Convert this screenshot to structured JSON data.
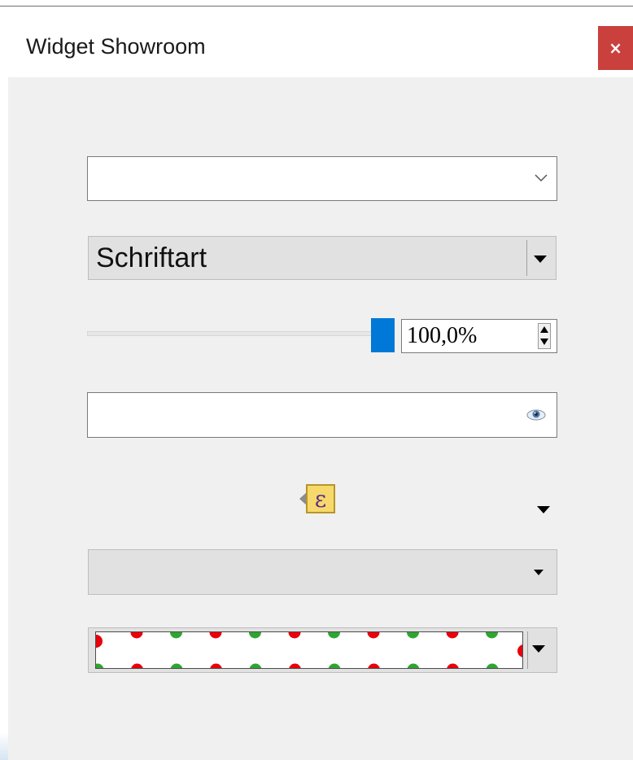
{
  "window": {
    "title": "Widget Showroom",
    "close_label": "×"
  },
  "icons": {
    "combo1_arrow": "chevron-down-icon",
    "font_dropdown": "triangle-down-icon",
    "spin_up": "spin-up-icon",
    "spin_down": "spin-down-icon",
    "password_toggle": "eye-icon",
    "expression": "expression-epsilon-icon",
    "combo_arrow": "triangle-down-icon"
  },
  "combo1": {
    "value": ""
  },
  "font_combo": {
    "value": "Schriftart"
  },
  "opacity": {
    "slider_fraction": 1.0,
    "spin_value": "100,0%"
  },
  "password_field": {
    "value": ""
  },
  "expression_button": {
    "glyph": "ε"
  },
  "combo3": {
    "value": ""
  },
  "pattern_combo": {
    "colors": [
      "#e8000b",
      "#2fa531",
      "#ffffff"
    ]
  },
  "colors": {
    "accent": "#0078d7",
    "close": "#c9403d",
    "panel": "#f0f0f0"
  }
}
